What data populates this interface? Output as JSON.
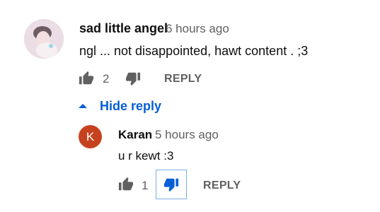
{
  "comment": {
    "author": "sad little angel",
    "time": "6 hours ago",
    "text": "ngl ... not disappointed, hawt content . ;3",
    "likes": "2",
    "reply_label": "REPLY"
  },
  "replies_toggle": {
    "label": "Hide reply"
  },
  "reply": {
    "avatar_letter": "K",
    "author": "Karan",
    "time": "5 hours ago",
    "text": "u r kewt :3",
    "likes": "1",
    "reply_label": "REPLY",
    "disliked": true
  },
  "colors": {
    "link_blue": "#065fd4",
    "icon_gray": "#606060",
    "avatar_reply_bg": "#c6421f"
  },
  "icons": {
    "like": "thumbs-up-icon",
    "dislike": "thumbs-down-icon",
    "collapse": "caret-up-icon"
  }
}
